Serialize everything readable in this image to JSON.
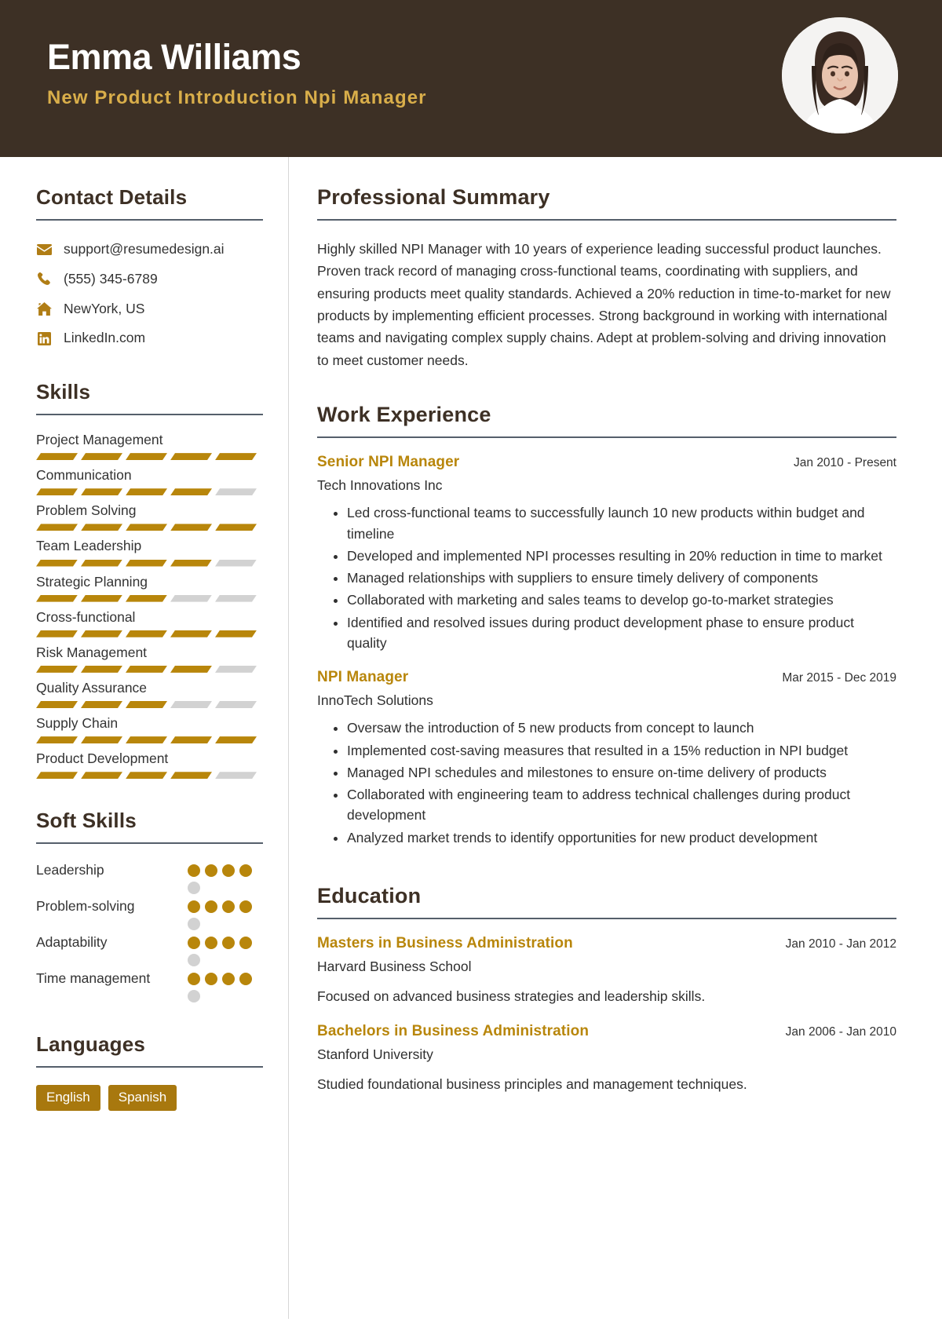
{
  "header": {
    "name": "Emma Williams",
    "job_title": "New Product Introduction Npi Manager",
    "bg_color": "#3d3025",
    "accent_color": "#d9ae4a",
    "avatar_icon": "profile-photo"
  },
  "theme": {
    "gold": "#b8860b",
    "gold_light": "#d9ae4a",
    "dark_brown": "#3d3025",
    "rule": "#555f6b",
    "muted": "#d2d2d2"
  },
  "sidebar": {
    "contact": {
      "title": "Contact Details",
      "items": [
        {
          "icon": "envelope-icon",
          "value": "support@resumedesign.ai"
        },
        {
          "icon": "phone-icon",
          "value": "(555) 345-6789"
        },
        {
          "icon": "home-icon",
          "value": "NewYork, US"
        },
        {
          "icon": "linkedin-icon",
          "value": "LinkedIn.com"
        }
      ]
    },
    "skills": {
      "title": "Skills",
      "max_level": 5,
      "items": [
        {
          "name": "Project Management",
          "level": 5
        },
        {
          "name": "Communication",
          "level": 4
        },
        {
          "name": "Problem Solving",
          "level": 5
        },
        {
          "name": "Team Leadership",
          "level": 4
        },
        {
          "name": "Strategic Planning",
          "level": 3
        },
        {
          "name": "Cross-functional",
          "level": 5
        },
        {
          "name": "Risk Management",
          "level": 4
        },
        {
          "name": "Quality Assurance",
          "level": 3
        },
        {
          "name": "Supply Chain",
          "level": 5
        },
        {
          "name": "Product Development",
          "level": 4
        }
      ]
    },
    "soft_skills": {
      "title": "Soft Skills",
      "max_level": 5,
      "items": [
        {
          "name": "Leadership",
          "level": 4
        },
        {
          "name": "Problem-solving",
          "level": 4
        },
        {
          "name": "Adaptability",
          "level": 4
        },
        {
          "name": "Time management",
          "level": 4
        }
      ]
    },
    "languages": {
      "title": "Languages",
      "items": [
        "English",
        "Spanish"
      ]
    }
  },
  "main": {
    "summary": {
      "title": "Professional Summary",
      "text": "Highly skilled NPI Manager with 10 years of experience leading successful product launches. Proven track record of managing cross-functional teams, coordinating with suppliers, and ensuring products meet quality standards. Achieved a 20% reduction in time-to-market for new products by implementing efficient processes. Strong background in working with international teams and navigating complex supply chains. Adept at problem-solving and driving innovation to meet customer needs."
    },
    "experience": {
      "title": "Work Experience",
      "entries": [
        {
          "role": "Senior NPI Manager",
          "date": "Jan 2010 - Present",
          "org": "Tech Innovations Inc",
          "bullets": [
            "Led cross-functional teams to successfully launch 10 new products within budget and timeline",
            "Developed and implemented NPI processes resulting in 20% reduction in time to market",
            "Managed relationships with suppliers to ensure timely delivery of components",
            "Collaborated with marketing and sales teams to develop go-to-market strategies",
            "Identified and resolved issues during product development phase to ensure product quality"
          ]
        },
        {
          "role": "NPI Manager",
          "date": "Mar 2015 - Dec 2019",
          "org": "InnoTech Solutions",
          "bullets": [
            "Oversaw the introduction of 5 new products from concept to launch",
            "Implemented cost-saving measures that resulted in a 15% reduction in NPI budget",
            "Managed NPI schedules and milestones to ensure on-time delivery of products",
            "Collaborated with engineering team to address technical challenges during product development",
            "Analyzed market trends to identify opportunities for new product development"
          ]
        }
      ]
    },
    "education": {
      "title": "Education",
      "entries": [
        {
          "degree": "Masters in Business Administration",
          "date": "Jan 2010 - Jan 2012",
          "school": "Harvard Business School",
          "description": "Focused on advanced business strategies and leadership skills."
        },
        {
          "degree": "Bachelors in Business Administration",
          "date": "Jan 2006 - Jan 2010",
          "school": "Stanford University",
          "description": "Studied foundational business principles and management techniques."
        }
      ]
    }
  }
}
